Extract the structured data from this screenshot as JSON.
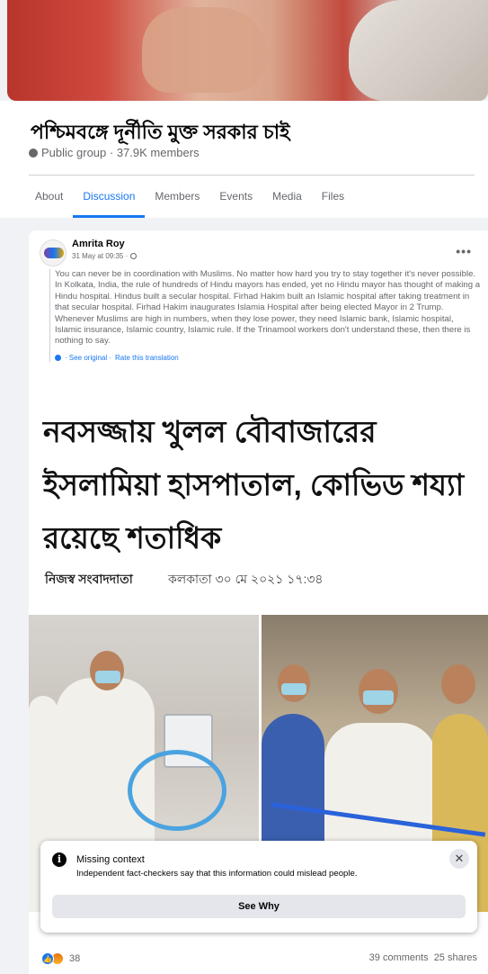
{
  "group": {
    "title": "পশ্চিমবঙ্গে দূর্নীতি মুক্ত সরকার চাই",
    "meta": "Public group · 37.9K members"
  },
  "tabs": [
    "About",
    "Discussion",
    "Members",
    "Events",
    "Media",
    "Files"
  ],
  "active_tab": "Discussion",
  "post": {
    "author": "Amrita Roy",
    "timestamp": "31 May at 09:35 ·",
    "text": "You can never be in coordination with Muslims. No matter how hard you try to stay together it's never possible. In Kolkata, India, the rule of hundreds of Hindu mayors has ended, yet no Hindu mayor has thought of making a Hindu hospital. Hindus built a secular hospital. Firhad Hakim built an Islamic hospital after taking treatment in that secular hospital. Firhad Hakim inaugurates Islamia Hospital after being elected Mayor in 2 Trump. Whenever Muslims are high in numbers, when they lose power, they need Islamic bank, Islamic hospital, Islamic insurance, Islamic country, Islamic rule. If the Trinamool workers don't understand these, then there is nothing to say.",
    "see_original": "· See original ·",
    "rate_translation": "Rate this translation",
    "more_icon": "more-horizontal-icon"
  },
  "news_image": {
    "headline": "নবসজ্জায় খুলল বৌবাজারের ইসলামিয়া হাসপাতাল, কোভিড শয্যা রয়েছে শতাধিক",
    "byline": "নিজস্ব সংবাদদাতা",
    "dateline": "কলকাতা ৩০ মে ২০২১ ১৭:৩৪"
  },
  "fact_check": {
    "title": "Missing context",
    "text": "Independent fact-checkers say that this information could mislead people.",
    "button": "See Why",
    "icon": "info-icon"
  },
  "footer": {
    "reaction_count": "38",
    "comments": "39 comments",
    "shares": "25 shares"
  },
  "colors": {
    "accent": "#1877f2",
    "background": "#f0f2f5",
    "secondary_text": "#65676b"
  }
}
